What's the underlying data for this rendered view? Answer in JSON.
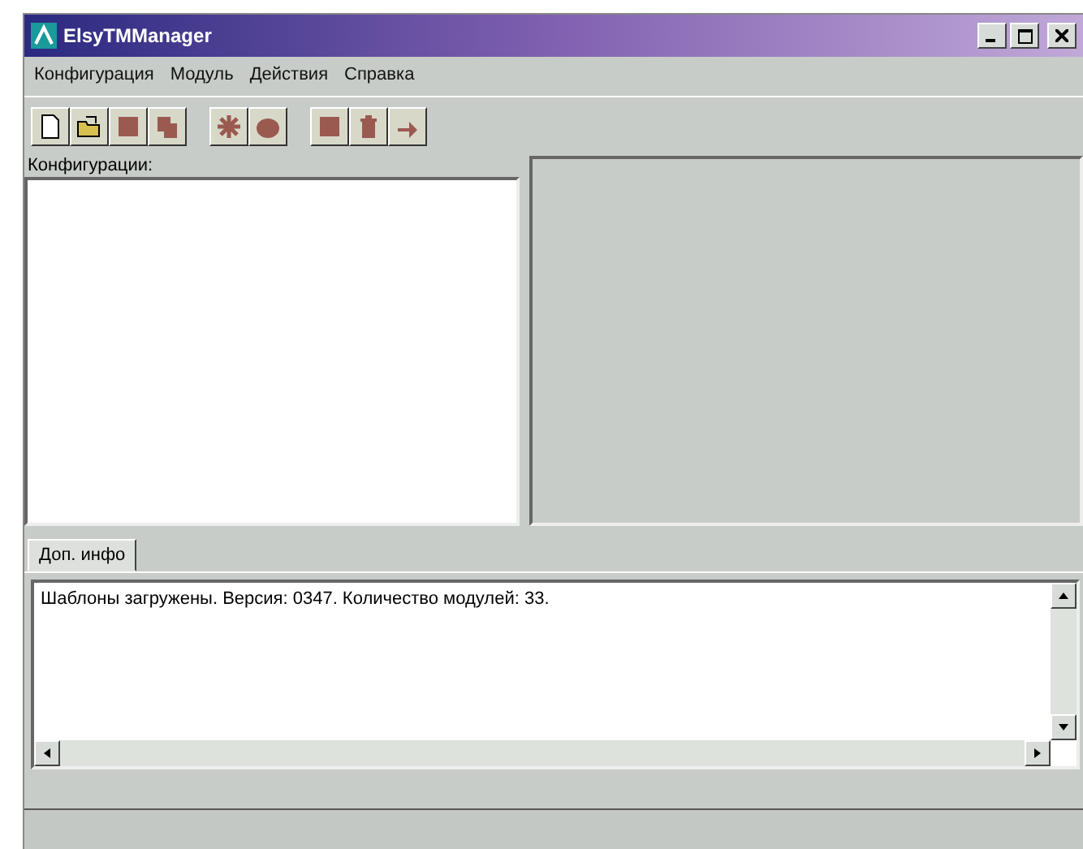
{
  "window": {
    "title": "ElsyTMManager"
  },
  "menu": [
    "Конфигурация",
    "Модуль",
    "Действия",
    "Справка"
  ],
  "config_panel": {
    "label": "Конфигурации:"
  },
  "tabs": [
    {
      "label": "Доп. инфо",
      "selected": true
    }
  ],
  "log": {
    "text": "Шаблоны загружены. Версия: 0347. Количество модулей: 33."
  }
}
